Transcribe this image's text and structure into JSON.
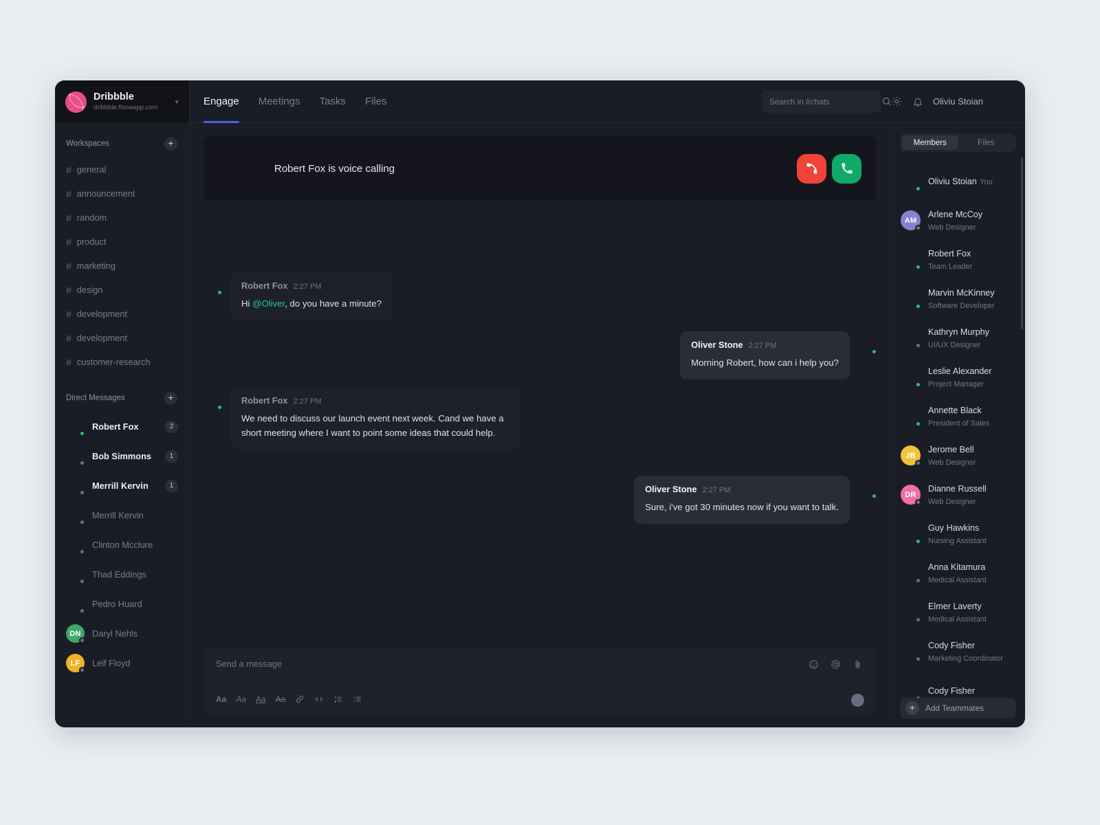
{
  "workspace": {
    "name": "Dribbble",
    "url": "dribbble.flooaapp.com",
    "caret_icon": "chevron-down-icon",
    "logo_icon": "dribbble-logo-icon"
  },
  "sidebar": {
    "workspaces_label": "Workspaces",
    "workspaces_add_icon": "plus-icon",
    "channels": [
      {
        "name": "general"
      },
      {
        "name": "announcement"
      },
      {
        "name": "random"
      },
      {
        "name": "product"
      },
      {
        "name": "marketing"
      },
      {
        "name": "design"
      },
      {
        "name": "development"
      },
      {
        "name": "development"
      },
      {
        "name": "customer-research"
      }
    ],
    "dm_label": "Direct Messages",
    "dm_add_icon": "plus-icon",
    "dms": [
      {
        "name": "Robert Fox",
        "badge": "2",
        "status": "online",
        "skin": "#8a5a42",
        "hair": "#241a15",
        "shirt": "#e8e9ee",
        "bg": "#9aa0a8"
      },
      {
        "name": "Bob Simmons",
        "badge": "1",
        "status": "offline",
        "skin": "#e8b894",
        "hair": "#4a3423",
        "shirt": "#3f4a63",
        "bg": "#5ba86a"
      },
      {
        "name": "Merrill Kervin",
        "badge": "1",
        "status": "offline",
        "skin": "#c98f63",
        "hair": "#1d1713",
        "shirt": "#7b8594",
        "bg": "#8b7fd1"
      },
      {
        "name": "Merrill Kervin",
        "badge": "",
        "status": "offline",
        "skin": "#7a4a2e",
        "hair": "#16100c",
        "shirt": "#f0f1f4",
        "bg": "#f5c13d"
      },
      {
        "name": "Clinton Mcclure",
        "badge": "",
        "status": "offline",
        "skin": "#d79a6c",
        "hair": "#1c1512",
        "shirt": "#2e3647",
        "bg": "#8ed3ea"
      },
      {
        "name": "Thad Eddings",
        "badge": "",
        "status": "offline",
        "skin": "#b2764a",
        "hair": "#1a120d",
        "shirt": "#2f7d68",
        "bg": "#f0a92b"
      },
      {
        "name": "Pedro Huard",
        "badge": "",
        "status": "offline",
        "skin": "#7c4c2f",
        "hair": "#140f0c",
        "shirt": "#e6c64a",
        "bg": "#e48ab5"
      },
      {
        "name": "Daryl Nehls",
        "badge": "",
        "status": "offline",
        "initials": "DN",
        "bg": "#3fa869"
      },
      {
        "name": "Leif Floyd",
        "badge": "",
        "status": "offline",
        "initials": "LF",
        "bg": "#f0b429"
      }
    ]
  },
  "topbar": {
    "tabs": [
      {
        "label": "Engage",
        "active": true
      },
      {
        "label": "Meetings",
        "active": false
      },
      {
        "label": "Tasks",
        "active": false
      },
      {
        "label": "Files",
        "active": false
      }
    ],
    "search_placeholder": "Search in #chats",
    "search_value": "",
    "search_icon": "search-icon",
    "settings_icon": "gear-icon",
    "notifications_icon": "bell-icon",
    "user_name": "Oliviu Stoian",
    "user_avatar_icon": "avatar"
  },
  "call_banner": {
    "text": "Robert Fox is voice calling",
    "decline_icon": "phone-decline-icon",
    "accept_icon": "phone-accept-icon",
    "decline_color": "#f04438",
    "accept_color": "#0fa968"
  },
  "messages": [
    {
      "author": "Robert Fox",
      "time": "2:27 PM",
      "side": "in",
      "text_before": "Hi ",
      "mention": "@Oliver",
      "text_after": ", do you have a minute?"
    },
    {
      "author": "Oliver Stone",
      "time": "2:27 PM",
      "side": "out",
      "text": "Morning Robert, how can i help you?"
    },
    {
      "author": "Robert Fox",
      "time": "2:27 PM",
      "side": "in",
      "text": "We need to discuss our launch event next week. Cand we have a short meeting where I want to point some ideas that could help."
    },
    {
      "author": "Oliver Stone",
      "time": "2:27 PM",
      "side": "out",
      "text": "Sure, i've got 30 minutes now if you want to talk."
    }
  ],
  "composer": {
    "placeholder": "Send a message",
    "value": "",
    "emoji_icon": "emoji-icon",
    "mention_icon": "at-mention-icon",
    "attach_icon": "paperclip-icon",
    "send_icon": "send-icon",
    "format_buttons": [
      {
        "label": "Aa",
        "style": "b",
        "name": "bold"
      },
      {
        "label": "Aa",
        "style": "i",
        "name": "italic"
      },
      {
        "label": "Aa",
        "style": "u",
        "name": "underline"
      },
      {
        "label": "Aa",
        "style": "s",
        "name": "strikethrough"
      },
      {
        "label": "link",
        "style": "icon",
        "name": "link"
      },
      {
        "label": "code",
        "style": "icon",
        "name": "code"
      },
      {
        "label": "ordered-list",
        "style": "icon",
        "name": "ordered-list"
      },
      {
        "label": "bullet-list",
        "style": "icon",
        "name": "bullet-list"
      }
    ]
  },
  "right_panel": {
    "tabs": [
      {
        "label": "Members",
        "active": true
      },
      {
        "label": "Files",
        "active": false
      }
    ],
    "members": [
      {
        "name": "Oliviu Stoian",
        "role": "You",
        "status": "online",
        "skin": "#e9bd97",
        "hair": "#2b2118",
        "shirt": "#2b2f38",
        "bg": "#dfe2e8"
      },
      {
        "name": "Arlene McCoy",
        "role": "Web Designer",
        "status": "offline",
        "initials": "AM",
        "bg": "#8b7fd1"
      },
      {
        "name": "Robert Fox",
        "role": "Team Leader",
        "status": "online",
        "skin": "#5c3a25",
        "hair": "#150f0b",
        "shirt": "#f2f3f6",
        "bg": "#7fa8d4"
      },
      {
        "name": "Marvin McKinney",
        "role": "Software Developer",
        "status": "online",
        "skin": "#e7b58d",
        "hair": "#3c2a1c",
        "shirt": "#9aa2b0",
        "bg": "#ef9433"
      },
      {
        "name": "Kathryn Murphy",
        "role": "UI/UX Designer",
        "status": "offline",
        "skin": "#edc6a6",
        "hair": "#3d2418",
        "shirt": "#4a3b33",
        "bg": "#ef8fb4"
      },
      {
        "name": "Leslie Alexander",
        "role": "Project Manager",
        "status": "online",
        "skin": "#eec4a2",
        "hair": "#4b3322",
        "shirt": "#46566b",
        "bg": "#8ec9e8"
      },
      {
        "name": "Annette Black",
        "role": "President of Sales",
        "status": "online",
        "skin": "#e9bd97",
        "hair": "#2e1d12",
        "shirt": "#d8d3cd",
        "bg": "#f08a3c"
      },
      {
        "name": "Jerome Bell",
        "role": "Web Designer",
        "status": "offline",
        "initials": "JB",
        "bg": "#f0c33c"
      },
      {
        "name": "Dianne Russell",
        "role": "Web Designer",
        "status": "offline",
        "initials": "DR",
        "bg": "#ef6fa8"
      },
      {
        "name": "Guy Hawkins",
        "role": "Nursing Assistant",
        "status": "online",
        "skin": "#e8b894",
        "hair": "#3a2719",
        "shirt": "#5a6478",
        "bg": "#7f8fd8"
      },
      {
        "name": "Anna Kitamura",
        "role": "Medical Assistant",
        "status": "offline",
        "skin": "#f0cdad",
        "hair": "#d8b56a",
        "shirt": "#e8e9ed",
        "bg": "#74cf9c"
      },
      {
        "name": "Elmer Laverty",
        "role": "Medical Assistant",
        "status": "offline",
        "skin": "#6b4630",
        "hair": "#120d09",
        "shirt": "#757f92",
        "bg": "#7f8fd8"
      },
      {
        "name": "Cody Fisher",
        "role": "Marketing Coordinator",
        "status": "offline",
        "skin": "#e5b48d",
        "hair": "#2a1b12",
        "shirt": "#edc13c",
        "bg": "#ef5f6e"
      },
      {
        "name": "Cody Fisher",
        "role": "",
        "status": "offline",
        "skin": "#6d4630",
        "hair": "#120c08",
        "shirt": "#2b2f38",
        "bg": "#f0a12b"
      }
    ],
    "add_teammates_label": "Add Teammates",
    "add_icon": "plus-icon"
  }
}
